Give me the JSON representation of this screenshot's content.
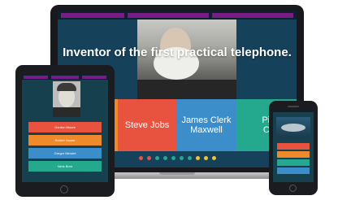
{
  "colors": {
    "screen_bg": "#16415a",
    "accent_purple": "#7a1c86",
    "answer_red": "#e8533f",
    "answer_blue": "#3b8ec9",
    "answer_teal": "#24a88e",
    "answer_orange": "#ee8a2b"
  },
  "laptop": {
    "question": "Inventor of the first practical telephone.",
    "answers": [
      "Steve Jobs",
      "James Clerk Maxwell",
      "Pierre Curie"
    ],
    "progress_dot_colors": [
      "#e8533f",
      "#e8533f",
      "#24a88e",
      "#24a88e",
      "#24a88e",
      "#24a88e",
      "#24a88e",
      "#f2c233",
      "#f2c233",
      "#f2c233"
    ]
  },
  "tablet": {
    "answers": [
      "Gordon Moore",
      "Robert Hooke",
      "Gregor Mendel",
      "Niels Bohr"
    ]
  },
  "phone": {
    "answer_colors": [
      "#e8533f",
      "#ee8a2b",
      "#24a88e",
      "#3b8ec9",
      "#24a88e"
    ]
  }
}
